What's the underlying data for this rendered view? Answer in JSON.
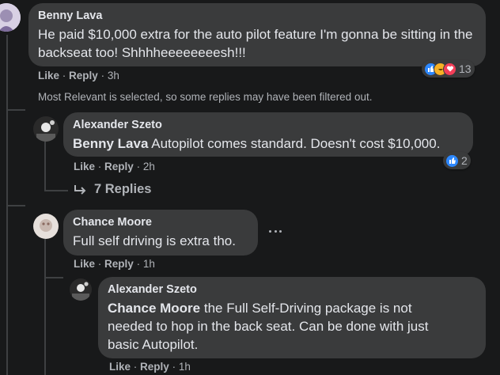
{
  "comments": [
    {
      "author": "Benny Lava",
      "text": "He paid $10,000 extra for the auto pilot feature I'm gonna be sitting in the backseat too! Shhhheeeeeeeesh!!!",
      "like_label": "Like",
      "reply_label": "Reply",
      "time": "3h",
      "reaction_count": "13",
      "reaction_icons": [
        "like-icon",
        "haha-icon",
        "love-icon"
      ]
    },
    {
      "author": "Alexander Szeto",
      "mention": "Benny Lava",
      "text": "Autopilot comes standard. Doesn't cost $10,000.",
      "like_label": "Like",
      "reply_label": "Reply",
      "time": "2h",
      "reaction_count": "2",
      "reaction_icons": [
        "like-icon"
      ]
    },
    {
      "author": "Chance Moore",
      "text": "Full self driving is extra tho.",
      "like_label": "Like",
      "reply_label": "Reply",
      "time": "1h",
      "menu_icon": "more-options-icon"
    },
    {
      "author": "Alexander Szeto",
      "mention": "Chance Moore",
      "text": "the Full Self-Driving package is not needed to hop in the back seat. Can be done with just basic Autopilot.",
      "like_label": "Like",
      "reply_label": "Reply",
      "time": "1h"
    }
  ],
  "filter_notice": "Most Relevant is selected, so some replies may have been filtered out.",
  "view_replies_label": "7 Replies",
  "separator": "·",
  "colors": {
    "background": "#18191a",
    "bubble": "#3a3b3c",
    "text": "#e4e6eb",
    "secondary": "#b0b3b8",
    "like_blue": "#2d88ff",
    "love_red": "#f33e58",
    "haha_yellow": "#f7b125"
  }
}
